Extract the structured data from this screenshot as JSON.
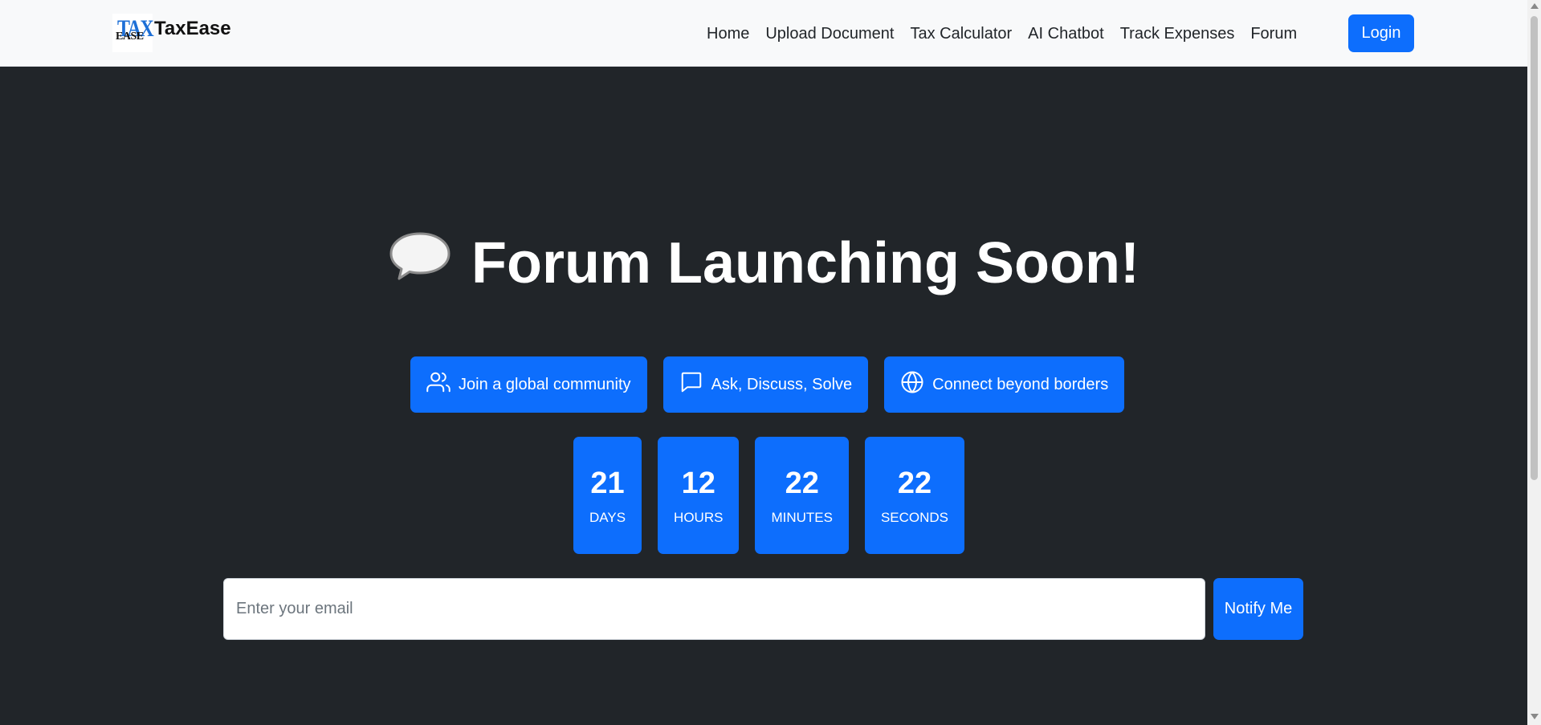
{
  "navbar": {
    "logo_tax": "TAX",
    "logo_ease": "EASE",
    "brand": "TaxEase",
    "links": [
      "Home",
      "Upload Document",
      "Tax Calculator",
      "AI Chatbot",
      "Track Expenses",
      "Forum"
    ],
    "login_label": "Login"
  },
  "hero": {
    "title": "Forum Launching Soon!",
    "icon": "speech-bubble-icon"
  },
  "features": [
    {
      "label": "Join a global community",
      "icon": "users-icon"
    },
    {
      "label": "Ask, Discuss, Solve",
      "icon": "chat-icon"
    },
    {
      "label": "Connect beyond borders",
      "icon": "globe-icon"
    }
  ],
  "countdown": [
    {
      "value": "21",
      "label": "DAYS"
    },
    {
      "value": "12",
      "label": "HOURS"
    },
    {
      "value": "22",
      "label": "MINUTES"
    },
    {
      "value": "22",
      "label": "SECONDS"
    }
  ],
  "notify": {
    "placeholder": "Enter your email",
    "button_label": "Notify Me"
  },
  "colors": {
    "accent": "#0d6efd",
    "background": "#212529",
    "navbar": "#f8f9fa"
  }
}
